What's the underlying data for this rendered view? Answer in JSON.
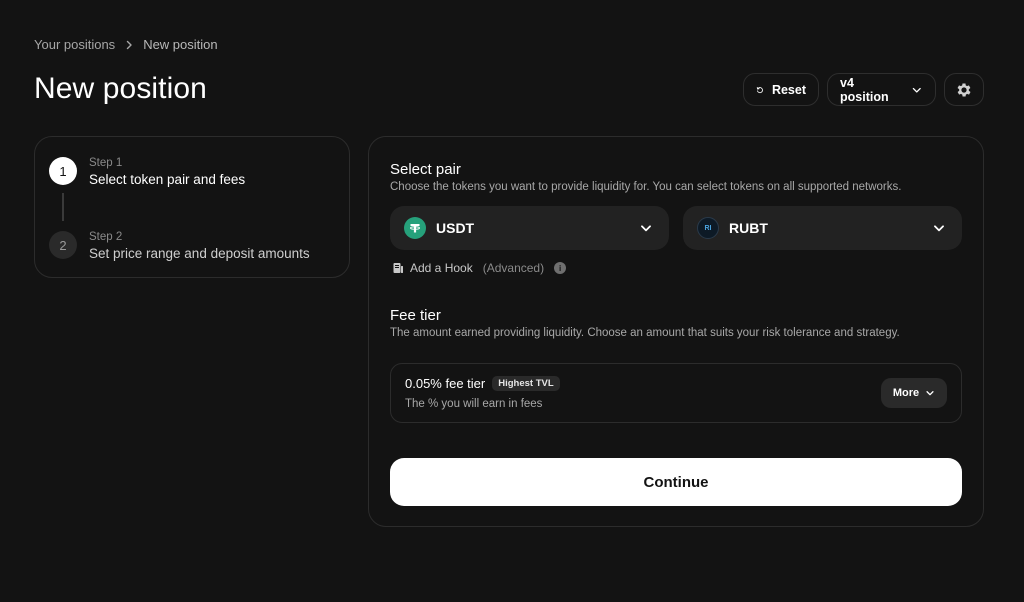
{
  "breadcrumb": {
    "parent": "Your positions",
    "current": "New position"
  },
  "page": {
    "title": "New position"
  },
  "controls": {
    "reset_label": "Reset",
    "version_label": "v4 position"
  },
  "stepper": {
    "steps": [
      {
        "number": "1",
        "label": "Step 1",
        "title": "Select token pair and fees"
      },
      {
        "number": "2",
        "label": "Step 2",
        "title": "Set price range and deposit amounts"
      }
    ]
  },
  "pair": {
    "title": "Select pair",
    "description": "Choose the tokens you want to provide liquidity for. You can select tokens on all supported networks.",
    "token_a": {
      "symbol": "USDT",
      "icon": "usdt-icon"
    },
    "token_b": {
      "symbol": "RUBT",
      "icon": "rubt-icon",
      "icon_text": "RI"
    },
    "hook_label": "Add a Hook",
    "hook_note": "(Advanced)"
  },
  "fee": {
    "title": "Fee tier",
    "description": "The amount earned providing liquidity. Choose an amount that suits your risk tolerance and strategy.",
    "selected": "0.05% fee tier",
    "badge": "Highest TVL",
    "subtext": "The % you will earn in fees",
    "more_label": "More"
  },
  "continue_label": "Continue",
  "colors": {
    "background": "#131313",
    "card_border": "#2c2c2c",
    "input_bg": "#222222",
    "usdt_green": "#26a17b",
    "primary_button": "#ffffff"
  }
}
